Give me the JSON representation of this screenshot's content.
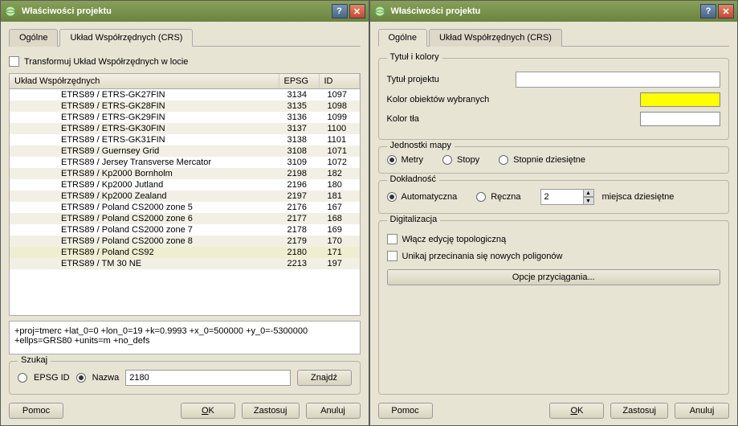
{
  "windowTitle": "Właściwości projektu",
  "tabs": {
    "general": "Ogólne",
    "crs": "Układ Współrzędnych (CRS)"
  },
  "checkboxTransform": "Transformuj Układ Współrzędnych w locie",
  "headers": {
    "c1": "Układ Współrzędnych",
    "c2": "EPSG",
    "c3": "ID"
  },
  "rows": [
    {
      "n": "ETRS89 / ETRS-GK27FIN",
      "e": "3134",
      "i": "1097"
    },
    {
      "n": "ETRS89 / ETRS-GK28FIN",
      "e": "3135",
      "i": "1098"
    },
    {
      "n": "ETRS89 / ETRS-GK29FIN",
      "e": "3136",
      "i": "1099"
    },
    {
      "n": "ETRS89 / ETRS-GK30FIN",
      "e": "3137",
      "i": "1100"
    },
    {
      "n": "ETRS89 / ETRS-GK31FIN",
      "e": "3138",
      "i": "1101"
    },
    {
      "n": "ETRS89 / Guernsey Grid",
      "e": "3108",
      "i": "1071"
    },
    {
      "n": "ETRS89 / Jersey Transverse Mercator",
      "e": "3109",
      "i": "1072"
    },
    {
      "n": "ETRS89 / Kp2000 Bornholm",
      "e": "2198",
      "i": "182"
    },
    {
      "n": "ETRS89 / Kp2000 Jutland",
      "e": "2196",
      "i": "180"
    },
    {
      "n": "ETRS89 / Kp2000 Zealand",
      "e": "2197",
      "i": "181"
    },
    {
      "n": "ETRS89 / Poland CS2000 zone 5",
      "e": "2176",
      "i": "167"
    },
    {
      "n": "ETRS89 / Poland CS2000 zone 6",
      "e": "2177",
      "i": "168"
    },
    {
      "n": "ETRS89 / Poland CS2000 zone 7",
      "e": "2178",
      "i": "169"
    },
    {
      "n": "ETRS89 / Poland CS2000 zone 8",
      "e": "2179",
      "i": "170"
    },
    {
      "n": "ETRS89 / Poland CS92",
      "e": "2180",
      "i": "171",
      "sel": true
    },
    {
      "n": "ETRS89 / TM 30 NE",
      "e": "2213",
      "i": "197"
    }
  ],
  "projString": "+proj=tmerc +lat_0=0 +lon_0=19 +k=0.9993 +x_0=500000 +y_0=-5300000 +ellps=GRS80 +units=m +no_defs",
  "search": {
    "legend": "Szukaj",
    "epsg": "EPSG ID",
    "name": "Nazwa",
    "value": "2180",
    "find": "Znajdź"
  },
  "buttons": {
    "help": "Pomoc",
    "okPrefix": "O",
    "okRest": "K",
    "apply": "Zastosuj",
    "cancel": "Anuluj"
  },
  "general": {
    "titleGroup": "Tytuł i kolory",
    "projectTitle": "Tytuł projektu",
    "selColor": "Kolor obiektów wybranych",
    "bgColor": "Kolor tła",
    "unitsGroup": "Jednostki mapy",
    "meters": "Metry",
    "feet": "Stopy",
    "decimal": "Stopnie dziesiętne",
    "accGroup": "Dokładność",
    "auto": "Automatyczna",
    "manual": "Ręczna",
    "decPlaces": "miejsca dziesiętne",
    "decValue": "2",
    "digGroup": "Digitalizacja",
    "topoEdit": "Włącz edycję topologiczną",
    "avoidIntersect": "Unikaj przecinania się nowych poligonów",
    "snapOptions": "Opcje przyciągania..."
  }
}
